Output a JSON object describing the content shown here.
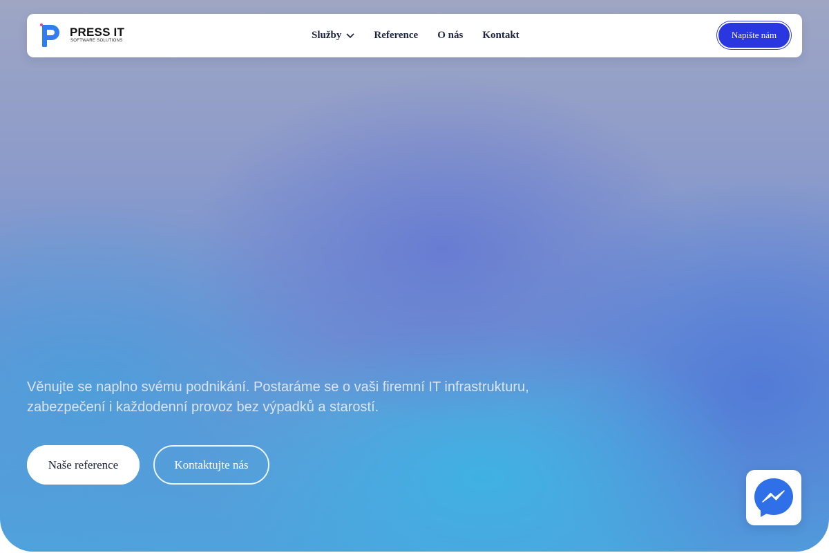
{
  "brand": {
    "name": "PRESS IT",
    "tagline": "SOFTWARE SOLUTIONS",
    "colors": {
      "accent": "#2a36e0",
      "logo_blue": "#2f7ef0",
      "logo_pink": "#d8509b"
    }
  },
  "nav": {
    "items": [
      {
        "label": "Služby",
        "has_dropdown": true,
        "icon": "chevron-down-icon"
      },
      {
        "label": "Reference"
      },
      {
        "label": "O nás"
      },
      {
        "label": "Kontakt"
      }
    ],
    "cta_label": "Napište nám"
  },
  "hero": {
    "lead_line1": "Věnujte se naplno svému podnikání. Postaráme se o vaši firemní IT infrastrukturu,",
    "lead_line2": "zabezpečení i každodenní provoz bez výpadků a starostí.",
    "primary_button": "Naše reference",
    "secondary_button": "Kontaktujte nás"
  },
  "chat_widget": {
    "icon": "messenger-icon",
    "color": "#2f6fe8"
  }
}
